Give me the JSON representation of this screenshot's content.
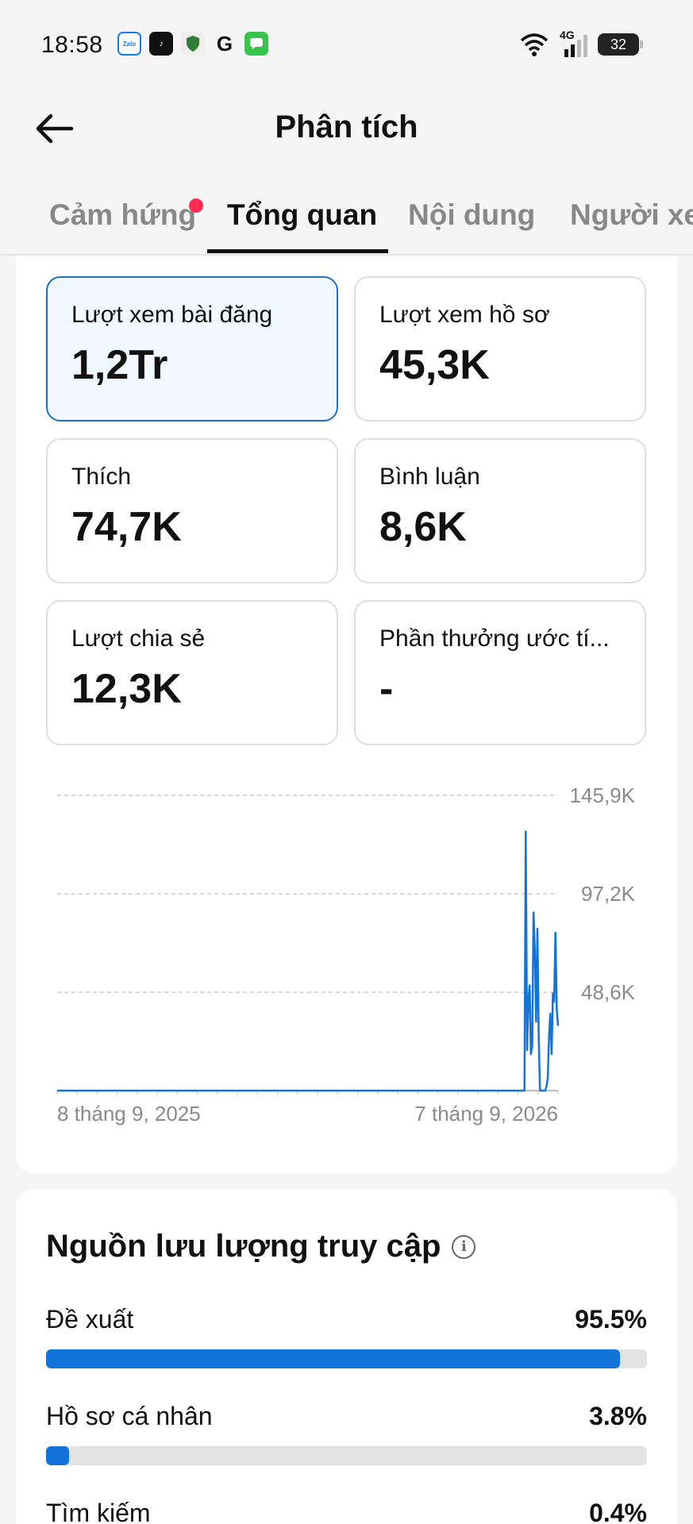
{
  "status_bar": {
    "time": "18:58",
    "app_icons": [
      "zalo-icon",
      "tiktok-icon",
      "shield-icon",
      "google-icon",
      "messages-icon"
    ],
    "network": "4G",
    "battery": "32"
  },
  "header": {
    "title": "Phân tích"
  },
  "tabs": [
    {
      "label": "Cảm hứng",
      "active": false,
      "has_dot": true
    },
    {
      "label": "Tổng quan",
      "active": true
    },
    {
      "label": "Nội dung",
      "active": false
    },
    {
      "label": "Người xe",
      "active": false
    }
  ],
  "metrics": [
    {
      "label": "Lượt xem bài đăng",
      "value": "1,2Tr",
      "selected": true
    },
    {
      "label": "Lượt xem hồ sơ",
      "value": "45,3K"
    },
    {
      "label": "Thích",
      "value": "74,7K"
    },
    {
      "label": "Bình luận",
      "value": "8,6K"
    },
    {
      "label": "Lượt chia sẻ",
      "value": "12,3K"
    },
    {
      "label": "Phần thưởng ước tí...",
      "value": "-"
    }
  ],
  "chart_data": {
    "type": "line",
    "y_ticks": [
      "145,9K",
      "97,2K",
      "48,6K"
    ],
    "y_tick_values": [
      145900,
      97200,
      48600
    ],
    "ylim": [
      0,
      145900
    ],
    "x_labels": [
      "8 tháng 9, 2025",
      "7 tháng 9, 2026"
    ],
    "grid": true,
    "color": "#1473d8",
    "series": [
      {
        "values": [
          0,
          0,
          0,
          0,
          0,
          0,
          0,
          0,
          0,
          0,
          0,
          0,
          0,
          0,
          0,
          0,
          0,
          0,
          0,
          0,
          0,
          0,
          0,
          0,
          0,
          0,
          0,
          0,
          0,
          0,
          0,
          0,
          0,
          0,
          0,
          0,
          0,
          0,
          0,
          0,
          0,
          0,
          0,
          0,
          0,
          0,
          0,
          0,
          0,
          0,
          0,
          0,
          0,
          0,
          0,
          0,
          0,
          0,
          0,
          0,
          0,
          0,
          0,
          0,
          0,
          0,
          0,
          0,
          0,
          0,
          0,
          0,
          0,
          0,
          0,
          0,
          0,
          0,
          0,
          0,
          0,
          0,
          0,
          0,
          0,
          0,
          0,
          0,
          0,
          0,
          0,
          0,
          0,
          0,
          0,
          0,
          0,
          0,
          0,
          0,
          0,
          0,
          0,
          0,
          0,
          0,
          0,
          0,
          0,
          0,
          0,
          0,
          0,
          0,
          0,
          0,
          0,
          0,
          0,
          0,
          0,
          0,
          0,
          0,
          0,
          0,
          0,
          0,
          0,
          0,
          0,
          0,
          0,
          0,
          0,
          0,
          0,
          0,
          0,
          0,
          0,
          0,
          0,
          0,
          0,
          0,
          0,
          0,
          0,
          0,
          0,
          0,
          0,
          0,
          0,
          0,
          0,
          0,
          0,
          0,
          0,
          0,
          0,
          0,
          0,
          0,
          0,
          0,
          0,
          0,
          0,
          0,
          0,
          0,
          0,
          0,
          0,
          0,
          0,
          0,
          0,
          0,
          0,
          0,
          0,
          0,
          0,
          0,
          0,
          0,
          0,
          0,
          0,
          0,
          0,
          0,
          0,
          0,
          0,
          0,
          0,
          0,
          0,
          0,
          0,
          0,
          0,
          0,
          0,
          0,
          0,
          0,
          0,
          0,
          0,
          0,
          0,
          0,
          0,
          0,
          0,
          0,
          0,
          0,
          0,
          0,
          0,
          0,
          0,
          0,
          0,
          0,
          0,
          0,
          0,
          0,
          0,
          0,
          0,
          0,
          0,
          0,
          0,
          0,
          0,
          0,
          0,
          0,
          0,
          0,
          0,
          0,
          0,
          0,
          0,
          0,
          0,
          0,
          0,
          0,
          0,
          0,
          0,
          0,
          0,
          0,
          0,
          0,
          0,
          0,
          0,
          0,
          0,
          0,
          0,
          0,
          0,
          0,
          0,
          0,
          0,
          0,
          0,
          0,
          0,
          0,
          0,
          0,
          0,
          0,
          0,
          0,
          0,
          0,
          0,
          0,
          0,
          0,
          0,
          0,
          0,
          0,
          0,
          0,
          0,
          0,
          0,
          0,
          0,
          0,
          0,
          0,
          0,
          0,
          0,
          0,
          0,
          0,
          0,
          0,
          0,
          0,
          0,
          0,
          0,
          0,
          0,
          0,
          0,
          0,
          0,
          0,
          0,
          0,
          0,
          0,
          0,
          0,
          0,
          0,
          0,
          0,
          0,
          0,
          0,
          0,
          0,
          0,
          0,
          0,
          0,
          0,
          0,
          0,
          0,
          0,
          0,
          0,
          0,
          0,
          0,
          0,
          0,
          128000,
          20000,
          45000,
          52000,
          18000,
          22000,
          88000,
          70000,
          34000,
          80000,
          28000,
          0,
          0,
          0,
          0,
          0,
          2000,
          6000,
          26000,
          38000,
          18000,
          48000,
          44000,
          78000,
          40000,
          32000
        ]
      }
    ]
  },
  "traffic": {
    "title": "Nguồn lưu lượng truy cập",
    "sources": [
      {
        "label": "Đề xuất",
        "percent": "95.5%",
        "value": 95.5
      },
      {
        "label": "Hồ sơ cá nhân",
        "percent": "3.8%",
        "value": 3.8
      },
      {
        "label": "Tìm kiếm",
        "percent": "0.4%",
        "value": 0.4
      }
    ]
  }
}
